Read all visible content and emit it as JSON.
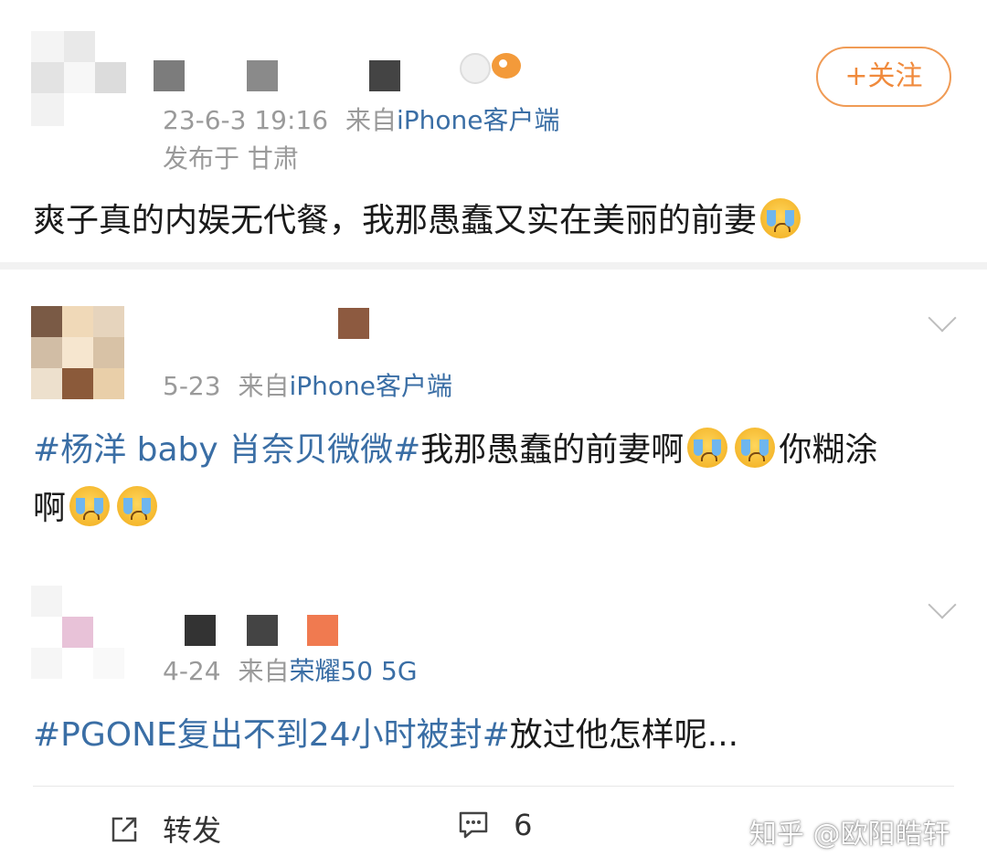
{
  "post1": {
    "meta_time": "23-6-3 19:16",
    "meta_from": "来自",
    "meta_source": "iPhone客户端",
    "location": "发布于 甘肃",
    "follow_label": "+关注",
    "text": "爽子真的内娱无代餐，我那愚蠢又实在美丽的前妻"
  },
  "post2": {
    "meta_time": "5-23",
    "meta_from": "来自",
    "meta_source": "iPhone客户端",
    "topic": "#杨洋 baby 肖奈贝微微#",
    "text_a": "我那愚蠢的前妻啊",
    "text_b": "你糊涂",
    "text_c": "啊"
  },
  "post3": {
    "meta_time": "4-24",
    "meta_from": "来自",
    "meta_source": "荣耀50 5G",
    "topic": "#PGONE复出不到24小时被封#",
    "text": "放过他怎样呢..."
  },
  "footer": {
    "repost_label": "转发",
    "comment_count": "6"
  },
  "watermark": "知乎 @欧阳皓轩",
  "colors": {
    "link": "#3a6ea5",
    "follow": "#f08a3c",
    "meta": "#9a9a9a"
  }
}
